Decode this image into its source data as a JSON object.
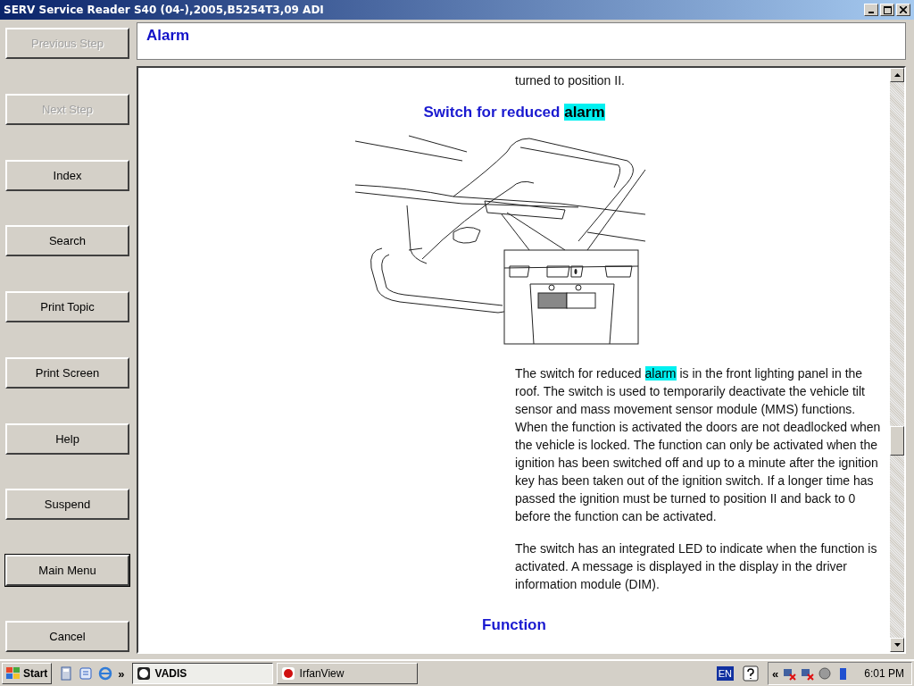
{
  "window": {
    "title": "SERV Service Reader S40 (04-),2005,B5254T3,09 ADI"
  },
  "sidebar": {
    "buttons": [
      {
        "label": "Previous Step",
        "disabled": true,
        "focused": false
      },
      {
        "label": "Next Step",
        "disabled": true,
        "focused": false
      },
      {
        "label": "Index",
        "disabled": false,
        "focused": false
      },
      {
        "label": "Search",
        "disabled": false,
        "focused": false
      },
      {
        "label": "Print Topic",
        "disabled": false,
        "focused": false
      },
      {
        "label": "Print Screen",
        "disabled": false,
        "focused": false
      },
      {
        "label": "Help",
        "disabled": false,
        "focused": false
      },
      {
        "label": "Suspend",
        "disabled": false,
        "focused": false
      },
      {
        "label": "Main Menu",
        "disabled": false,
        "focused": true
      },
      {
        "label": "Cancel",
        "disabled": false,
        "focused": false
      }
    ]
  },
  "header": {
    "title": "Alarm"
  },
  "document": {
    "intro_line": "turned to position II.",
    "heading": [
      {
        "text": "Switch for reduced ",
        "highlighted": false
      },
      {
        "text": "alarm",
        "highlighted": true
      }
    ],
    "paragraphs": [
      [
        {
          "text": "The switch for reduced ",
          "highlighted": false
        },
        {
          "text": "alarm",
          "highlighted": true
        },
        {
          "text": " is in the front lighting panel in the roof. The switch is used to temporarily deactivate the vehicle tilt sensor and mass movement sensor module (MMS) functions. When the function is activated the doors are not deadlocked when the vehicle is locked. The function can only be activated when the ignition has been switched off and up to a minute after the ignition key has been taken out of the ignition switch. If a longer time has passed the ignition must be turned to position II and back to 0 before the function can be activated.",
          "highlighted": false
        }
      ],
      [
        {
          "text": "The switch has an integrated LED to indicate when the function is activated. A message is displayed in the display in the driver information module (DIM).",
          "highlighted": false
        }
      ]
    ],
    "section_heading": "Function"
  },
  "taskbar": {
    "start": "Start",
    "overflow": "»",
    "tasks": [
      {
        "label": "VADIS",
        "selected": true
      },
      {
        "label": "IrfanView",
        "selected": false
      }
    ],
    "language": "EN",
    "tray_expand": "«",
    "clock": "6:01 PM"
  }
}
